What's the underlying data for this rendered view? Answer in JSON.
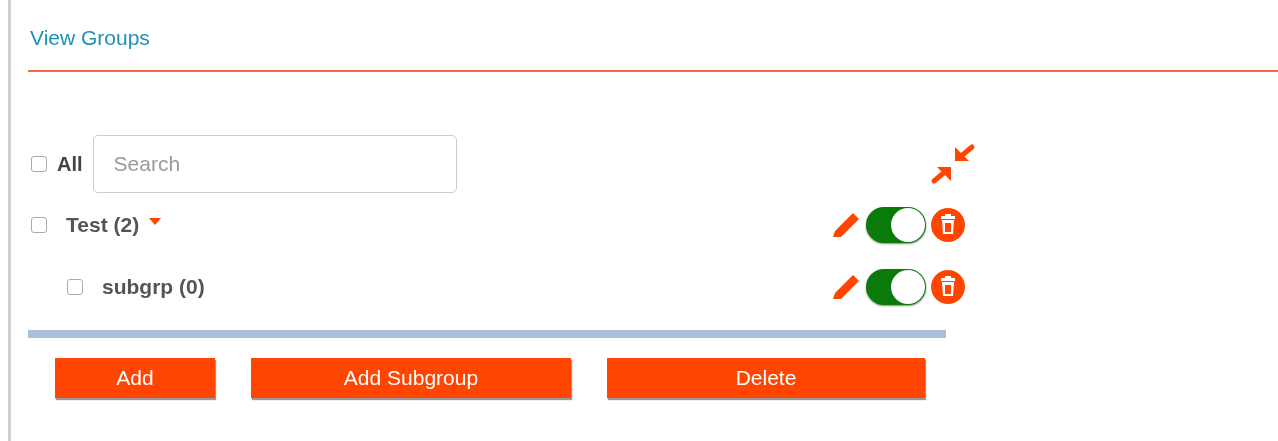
{
  "title": "View Groups",
  "select_all": {
    "label": "All",
    "checked": false
  },
  "search": {
    "placeholder": "Search"
  },
  "groups": [
    {
      "name": "Test (2)",
      "checked": false,
      "expanded": true,
      "enabled": true,
      "children": [
        {
          "name": "subgrp (0)",
          "checked": false,
          "enabled": true
        }
      ]
    }
  ],
  "buttons": [
    "Add",
    "Add Subgroup",
    "Delete"
  ]
}
